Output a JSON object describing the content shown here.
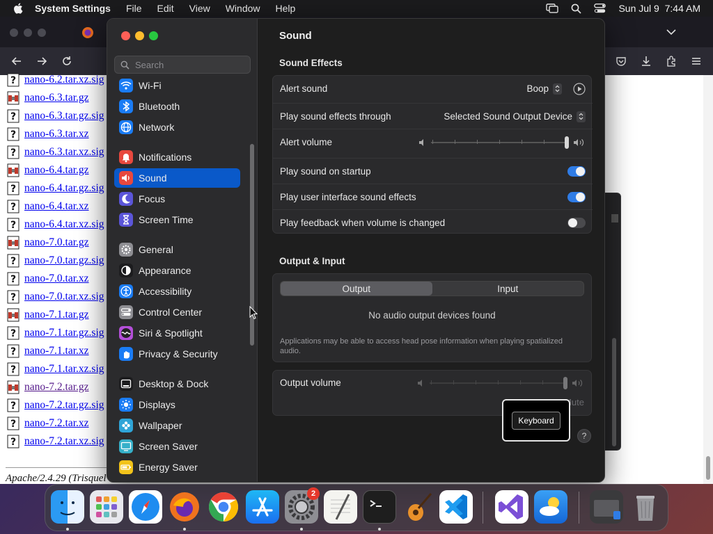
{
  "menubar": {
    "app_name": "System Settings",
    "menus": [
      "File",
      "Edit",
      "View",
      "Window",
      "Help"
    ],
    "clock": "Sun Jul 9  7:44 AM"
  },
  "browser": {
    "files": [
      {
        "name": "nano-6.2.tar.xz.sig",
        "type": "unknown"
      },
      {
        "name": "nano-6.3.tar.gz",
        "type": "archive"
      },
      {
        "name": "nano-6.3.tar.gz.sig",
        "type": "unknown"
      },
      {
        "name": "nano-6.3.tar.xz",
        "type": "unknown"
      },
      {
        "name": "nano-6.3.tar.xz.sig",
        "type": "unknown"
      },
      {
        "name": "nano-6.4.tar.gz",
        "type": "archive"
      },
      {
        "name": "nano-6.4.tar.gz.sig",
        "type": "unknown"
      },
      {
        "name": "nano-6.4.tar.xz",
        "type": "unknown"
      },
      {
        "name": "nano-6.4.tar.xz.sig",
        "type": "unknown"
      },
      {
        "name": "nano-7.0.tar.gz",
        "type": "archive"
      },
      {
        "name": "nano-7.0.tar.gz.sig",
        "type": "unknown"
      },
      {
        "name": "nano-7.0.tar.xz",
        "type": "unknown"
      },
      {
        "name": "nano-7.0.tar.xz.sig",
        "type": "unknown"
      },
      {
        "name": "nano-7.1.tar.gz",
        "type": "archive"
      },
      {
        "name": "nano-7.1.tar.gz.sig",
        "type": "unknown"
      },
      {
        "name": "nano-7.1.tar.xz",
        "type": "unknown"
      },
      {
        "name": "nano-7.1.tar.xz.sig",
        "type": "unknown"
      },
      {
        "name": "nano-7.2.tar.gz",
        "type": "archive",
        "visited": true
      },
      {
        "name": "nano-7.2.tar.gz.sig",
        "type": "unknown"
      },
      {
        "name": "nano-7.2.tar.xz",
        "type": "unknown"
      },
      {
        "name": "nano-7.2.tar.xz.sig",
        "type": "unknown"
      }
    ],
    "server_signature": "Apache/2.4.29 (Trisquel"
  },
  "settings": {
    "search_placeholder": "Search",
    "sidebar": [
      {
        "id": "wifi",
        "label": "Wi-Fi",
        "icon": "wifi-icon",
        "color": "#1a7cf5"
      },
      {
        "id": "bluetooth",
        "label": "Bluetooth",
        "icon": "bluetooth-icon",
        "color": "#1a7cf5"
      },
      {
        "id": "network",
        "label": "Network",
        "icon": "globe-icon",
        "color": "#1a7cf5"
      },
      {
        "id": "notifications",
        "label": "Notifications",
        "icon": "bell-icon",
        "color": "#e8483e"
      },
      {
        "id": "sound",
        "label": "Sound",
        "icon": "speaker-icon",
        "color": "#e8483e",
        "selected": true
      },
      {
        "id": "focus",
        "label": "Focus",
        "icon": "moon-icon",
        "color": "#5b55d9"
      },
      {
        "id": "screen-time",
        "label": "Screen Time",
        "icon": "hourglass-icon",
        "color": "#5b55d9"
      },
      {
        "id": "general",
        "label": "General",
        "icon": "gear-icon",
        "color": "#8e8e93"
      },
      {
        "id": "appearance",
        "label": "Appearance",
        "icon": "appearance-icon",
        "color": "#1c1c1e"
      },
      {
        "id": "accessibility",
        "label": "Accessibility",
        "icon": "accessibility-icon",
        "color": "#1a7cf5"
      },
      {
        "id": "control-center",
        "label": "Control Center",
        "icon": "switches-icon",
        "color": "#8e8e93"
      },
      {
        "id": "siri",
        "label": "Siri & Spotlight",
        "icon": "siri-icon",
        "color": "#b44fd9"
      },
      {
        "id": "privacy",
        "label": "Privacy & Security",
        "icon": "hand-icon",
        "color": "#1a7cf5"
      },
      {
        "id": "desktop-dock",
        "label": "Desktop & Dock",
        "icon": "dock-icon",
        "color": "#1c1c1e"
      },
      {
        "id": "displays",
        "label": "Displays",
        "icon": "sun-icon",
        "color": "#1a7cf5"
      },
      {
        "id": "wallpaper",
        "label": "Wallpaper",
        "icon": "flower-icon",
        "color": "#2fa5d8"
      },
      {
        "id": "screen-saver",
        "label": "Screen Saver",
        "icon": "screensaver-icon",
        "color": "#36b0c9"
      },
      {
        "id": "energy-saver",
        "label": "Energy Saver",
        "icon": "battery-icon",
        "color": "#f2c31a"
      }
    ],
    "title": "Sound",
    "effects": {
      "section_title": "Sound Effects",
      "alert_sound_label": "Alert sound",
      "alert_sound_value": "Boop",
      "output_through_label": "Play sound effects through",
      "output_through_value": "Selected Sound Output Device",
      "alert_volume_label": "Alert volume",
      "alert_volume_level": 1.0,
      "startup_label": "Play sound on startup",
      "startup_on": true,
      "ui_sounds_label": "Play user interface sound effects",
      "ui_sounds_on": true,
      "feedback_label": "Play feedback when volume is changed",
      "feedback_on": false
    },
    "output_input": {
      "section_title": "Output & Input",
      "tab_output": "Output",
      "tab_input": "Input",
      "empty_message": "No audio output devices found",
      "note": "Applications may be able to access head pose information when playing spatialized audio."
    },
    "output_volume": {
      "label": "Output volume",
      "level": 1.0,
      "mute_label": "Mute"
    },
    "help_label": "?"
  },
  "keyboard_overlay": {
    "label": "Keyboard"
  },
  "dock": {
    "settings_badge": "2"
  }
}
